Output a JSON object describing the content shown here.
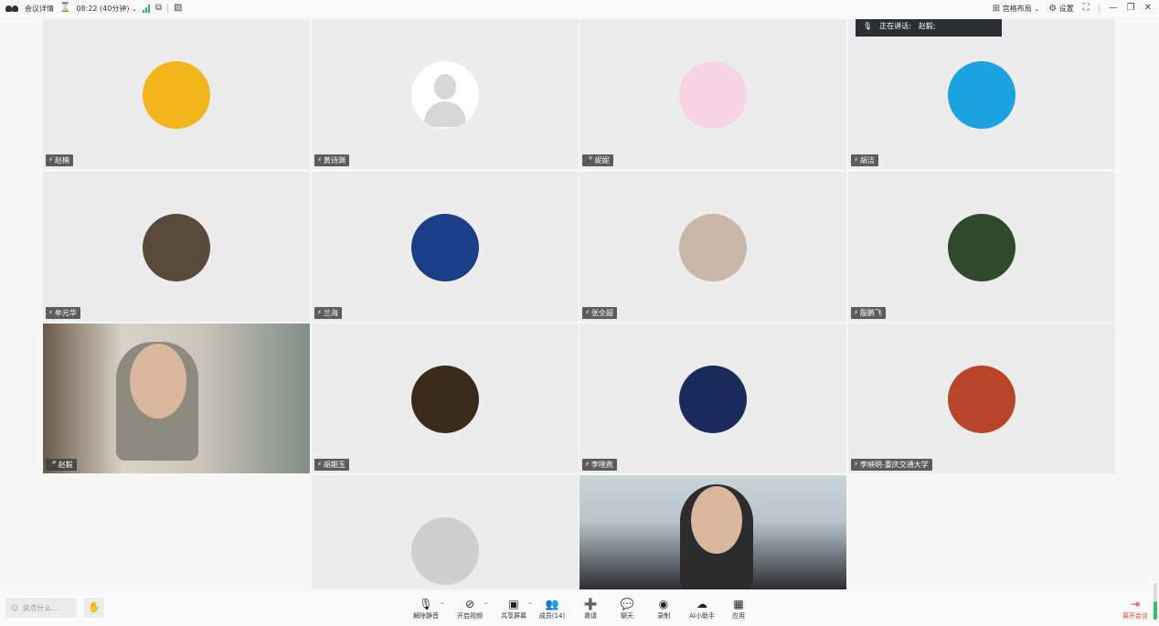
{
  "topbar": {
    "meeting_details": "会议详情",
    "timer": "08:22 (40分钟)",
    "layout": "宫格布局",
    "settings": "设置"
  },
  "speaking": {
    "label": "正在讲话:",
    "name": "赵毅;"
  },
  "participants": [
    {
      "name": "赵楠",
      "mic": "muted",
      "avatar_color": "#f2b51c"
    },
    {
      "name": "黄诗渊",
      "mic": "muted",
      "avatar_color": "#ffffff"
    },
    {
      "name": "妮妮",
      "mic": "on",
      "avatar_color": "#f7d4e3"
    },
    {
      "name": "胡洁",
      "mic": "muted",
      "avatar_color": "#1aa3e0"
    },
    {
      "name": "牟元华",
      "mic": "muted",
      "avatar_color": "#5a4a3a"
    },
    {
      "name": "兰海",
      "mic": "muted",
      "avatar_color": "#1a3f88"
    },
    {
      "name": "张全超",
      "mic": "muted",
      "avatar_color": "#c9b8a8"
    },
    {
      "name": "殷鹏飞",
      "mic": "muted",
      "avatar_color": "#2f4a2a"
    },
    {
      "name": "赵毅",
      "mic": "speaking",
      "avatar_color": "#8a8175"
    },
    {
      "name": "胡期玉",
      "mic": "muted",
      "avatar_color": "#3a2a1a"
    },
    {
      "name": "李晓燕",
      "mic": "muted",
      "avatar_color": "#1a2a5a"
    },
    {
      "name": "李映明-重庆交通大学",
      "mic": "muted",
      "avatar_color": "#b8452a"
    },
    {
      "name": "",
      "mic": "none",
      "avatar_color": "#cfcfcf"
    },
    {
      "name": "",
      "mic": "none",
      "avatar_color": "#a8b4bc"
    }
  ],
  "bottombar": {
    "chat_placeholder": "说点什么...",
    "tools": [
      {
        "label": "解除静音",
        "icon": "mic-muted-icon",
        "glyph": "🎙"
      },
      {
        "label": "开启视频",
        "icon": "camera-off-icon",
        "glyph": "⊘"
      },
      {
        "label": "共享屏幕",
        "icon": "share-screen-icon",
        "glyph": "▣"
      },
      {
        "label": "成员(14)",
        "icon": "members-icon",
        "glyph": "👥"
      },
      {
        "label": "邀请",
        "icon": "invite-icon",
        "glyph": "➕"
      },
      {
        "label": "聊天",
        "icon": "chat-icon",
        "glyph": "💬"
      },
      {
        "label": "录制",
        "icon": "record-icon",
        "glyph": "◉"
      },
      {
        "label": "AI小助手",
        "icon": "ai-assistant-icon",
        "glyph": "☁"
      },
      {
        "label": "应用",
        "icon": "apps-icon",
        "glyph": "▦"
      }
    ],
    "leave": "离开会议"
  }
}
